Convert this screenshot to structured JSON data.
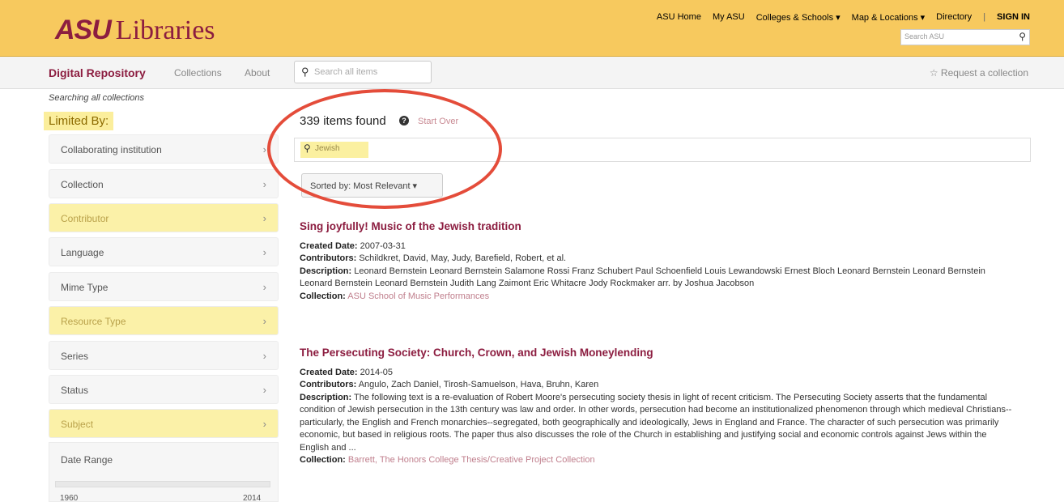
{
  "header": {
    "logo_mark": "ASU",
    "logo_text": "Libraries",
    "links": [
      "ASU Home",
      "My ASU",
      "Colleges & Schools ▾",
      "Map & Locations ▾",
      "Directory",
      "|",
      "SIGN IN"
    ],
    "search_placeholder": "Search ASU"
  },
  "nav": {
    "brand": "Digital Repository",
    "collections": "Collections",
    "about": "About",
    "search_placeholder": "Search all items",
    "request": "☆ Request a collection"
  },
  "sidebar": {
    "searching": "Searching all collections",
    "limited_by": "Limited By:",
    "facets": [
      {
        "label": "Collaborating institution",
        "highlighted": false
      },
      {
        "label": "Collection",
        "highlighted": false
      },
      {
        "label": "Contributor",
        "highlighted": true
      },
      {
        "label": "Language",
        "highlighted": false
      },
      {
        "label": "Mime Type",
        "highlighted": false
      },
      {
        "label": "Resource Type",
        "highlighted": true
      },
      {
        "label": "Series",
        "highlighted": false
      },
      {
        "label": "Status",
        "highlighted": false
      },
      {
        "label": "Subject",
        "highlighted": true
      }
    ],
    "date_range": {
      "label": "Date Range",
      "min": "1960",
      "max": "2014"
    }
  },
  "main": {
    "found": "339 items found",
    "start_over": "Start Over",
    "query": "Jewish",
    "sort": "Sorted by: Most Relevant ▾",
    "results": [
      {
        "title": "Sing joyfully! Music of the Jewish tradition",
        "created_label": "Created Date:",
        "created": "2007-03-31",
        "contributors_label": "Contributors:",
        "contributors": "Schildkret, David, May, Judy, Barefield, Robert, et al.",
        "description_label": "Description:",
        "description": "Leonard Bernstein Leonard Bernstein Salamone Rossi Franz Schubert Paul Schoenfield Louis Lewandowski Ernest Bloch Leonard Bernstein Leonard Bernstein Leonard Bernstein Leonard Bernstein Judith Lang Zaimont Eric Whitacre Jody Rockmaker arr. by Joshua Jacobson",
        "collection_label": "Collection:",
        "collection": "ASU School of Music Performances"
      },
      {
        "title": "The Persecuting Society: Church, Crown, and Jewish Moneylending",
        "created_label": "Created Date:",
        "created": "2014-05",
        "contributors_label": "Contributors:",
        "contributors": "Angulo, Zach Daniel, Tirosh-Samuelson, Hava, Bruhn, Karen",
        "description_label": "Description:",
        "description": "The following text is a re-evaluation of Robert Moore's persecuting society thesis in light of recent criticism. The Persecuting Society asserts that the fundamental condition of Jewish persecution in the 13th century was law and order. In other words, persecution had become an institutionalized phenomenon through which medieval Christians--particularly, the English and French monarchies--segregated, both geographically and ideologically, Jews in England and France. The character of such persecution was primarily economic, but based in religious roots. The paper thus also discusses the role of the Church in establishing and justifying social and economic controls against Jews within the English and ...",
        "collection_label": "Collection:",
        "collection": "Barrett, The Honors College Thesis/Creative Project Collection"
      }
    ]
  },
  "colors": {
    "header_bg": "#f7c95e",
    "brand": "#8c1d40",
    "highlight": "#fbf1a8",
    "annotation_circle": "#e44c3a"
  }
}
